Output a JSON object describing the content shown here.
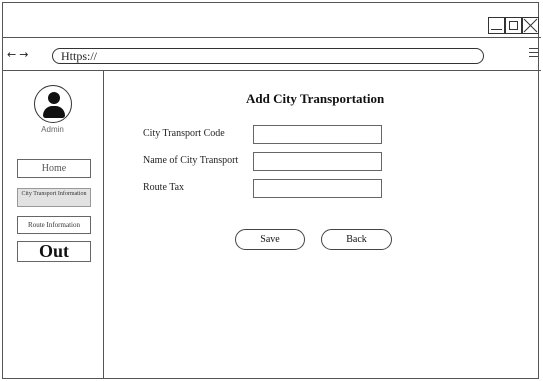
{
  "window": {
    "controls": [
      "minimize-icon",
      "maximize-icon",
      "close-icon"
    ]
  },
  "browser": {
    "back_arrow": "←",
    "forward_arrow": "→",
    "url": "Https://",
    "menu_icon": "hamburger-icon"
  },
  "sidebar": {
    "avatar_icon": "user-icon",
    "role": "Admin",
    "items": [
      {
        "label": "Home"
      },
      {
        "label": "City Transport Information",
        "active": true
      },
      {
        "label": "Route Information"
      },
      {
        "label": "Out"
      }
    ]
  },
  "main": {
    "title": "Add City Transportation",
    "fields": [
      {
        "label": "City Transport Code",
        "value": ""
      },
      {
        "label": "Name of City Transport",
        "value": ""
      },
      {
        "label": "Route Tax",
        "value": ""
      }
    ],
    "save_label": "Save",
    "back_label": "Back"
  }
}
